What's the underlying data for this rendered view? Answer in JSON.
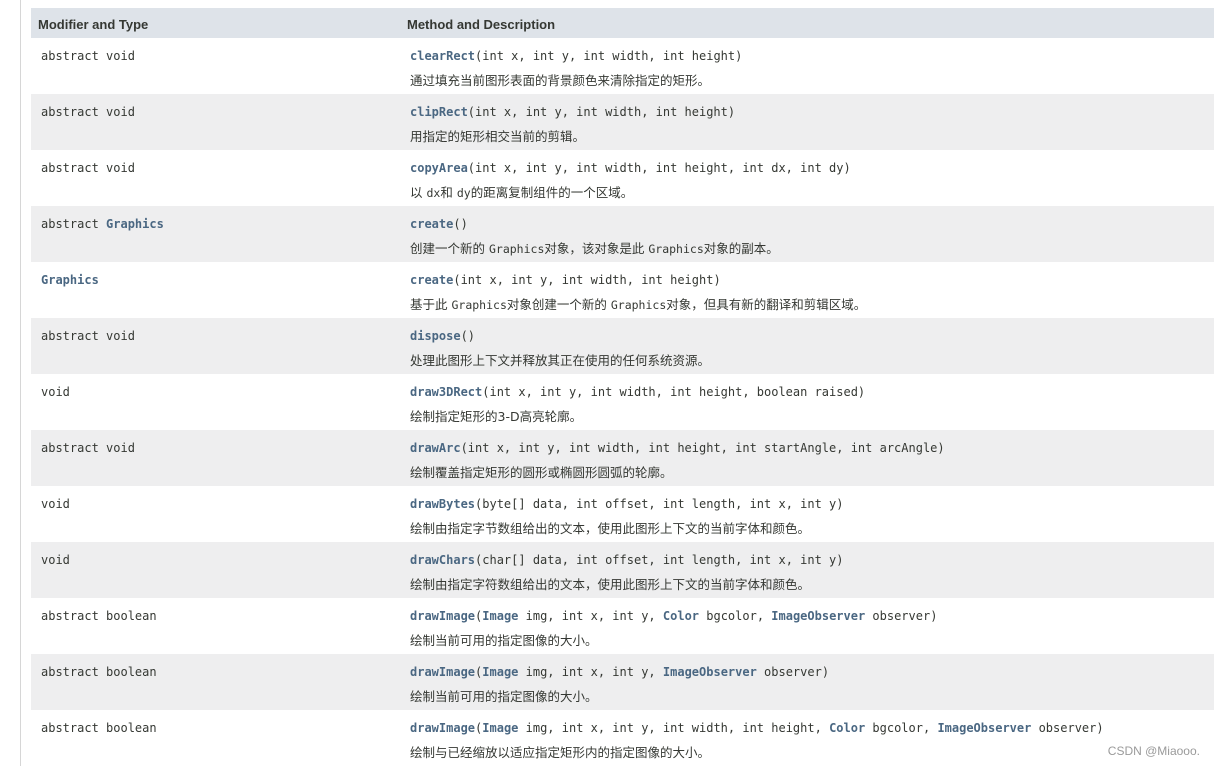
{
  "header": {
    "col1": "Modifier and Type",
    "col2": "Method and Description"
  },
  "rows": [
    {
      "modifier": [
        {
          "t": "abstract void"
        }
      ],
      "method": [
        {
          "t": "clearRect",
          "link": true
        },
        {
          "t": "(int x, int y, int width, int height)"
        }
      ],
      "description": [
        {
          "t": "通过填充当前图形表面的背景颜色来清除指定的矩形。"
        }
      ]
    },
    {
      "modifier": [
        {
          "t": "abstract void"
        }
      ],
      "method": [
        {
          "t": "clipRect",
          "link": true
        },
        {
          "t": "(int x, int y, int width, int height)"
        }
      ],
      "description": [
        {
          "t": "用指定的矩形相交当前的剪辑。"
        }
      ]
    },
    {
      "modifier": [
        {
          "t": "abstract void"
        }
      ],
      "method": [
        {
          "t": "copyArea",
          "link": true
        },
        {
          "t": "(int x, int y, int width, int height, int dx, int dy)"
        }
      ],
      "description": [
        {
          "t": "以 "
        },
        {
          "t": "dx",
          "code": true
        },
        {
          "t": "和 "
        },
        {
          "t": "dy",
          "code": true
        },
        {
          "t": "的距离复制组件的一个区域。"
        }
      ]
    },
    {
      "modifier": [
        {
          "t": "abstract "
        },
        {
          "t": "Graphics",
          "link": true
        }
      ],
      "method": [
        {
          "t": "create",
          "link": true
        },
        {
          "t": "()"
        }
      ],
      "description": [
        {
          "t": "创建一个新的 "
        },
        {
          "t": "Graphics",
          "code": true
        },
        {
          "t": "对象，该对象是此 "
        },
        {
          "t": "Graphics",
          "code": true
        },
        {
          "t": "对象的副本。"
        }
      ]
    },
    {
      "modifier": [
        {
          "t": "Graphics",
          "link": true
        }
      ],
      "method": [
        {
          "t": "create",
          "link": true
        },
        {
          "t": "(int x, int y, int width, int height)"
        }
      ],
      "description": [
        {
          "t": "基于此 "
        },
        {
          "t": "Graphics",
          "code": true
        },
        {
          "t": "对象创建一个新的 "
        },
        {
          "t": "Graphics",
          "code": true
        },
        {
          "t": "对象，但具有新的翻译和剪辑区域。"
        }
      ]
    },
    {
      "modifier": [
        {
          "t": "abstract void"
        }
      ],
      "method": [
        {
          "t": "dispose",
          "link": true
        },
        {
          "t": "()"
        }
      ],
      "description": [
        {
          "t": "处理此图形上下文并释放其正在使用的任何系统资源。"
        }
      ]
    },
    {
      "modifier": [
        {
          "t": "void"
        }
      ],
      "method": [
        {
          "t": "draw3DRect",
          "link": true
        },
        {
          "t": "(int x, int y, int width, int height, boolean raised)"
        }
      ],
      "description": [
        {
          "t": "绘制指定矩形的3-D高亮轮廓。"
        }
      ]
    },
    {
      "modifier": [
        {
          "t": "abstract void"
        }
      ],
      "method": [
        {
          "t": "drawArc",
          "link": true
        },
        {
          "t": "(int x, int y, int width, int height, int startAngle, int arcAngle)"
        }
      ],
      "description": [
        {
          "t": "绘制覆盖指定矩形的圆形或椭圆形圆弧的轮廓。"
        }
      ]
    },
    {
      "modifier": [
        {
          "t": "void"
        }
      ],
      "method": [
        {
          "t": "drawBytes",
          "link": true
        },
        {
          "t": "(byte[] data, int offset, int length, int x, int y)"
        }
      ],
      "description": [
        {
          "t": "绘制由指定字节数组给出的文本，使用此图形上下文的当前字体和颜色。"
        }
      ]
    },
    {
      "modifier": [
        {
          "t": "void"
        }
      ],
      "method": [
        {
          "t": "drawChars",
          "link": true
        },
        {
          "t": "(char[] data, int offset, int length, int x, int y)"
        }
      ],
      "description": [
        {
          "t": "绘制由指定字符数组给出的文本，使用此图形上下文的当前字体和颜色。"
        }
      ]
    },
    {
      "modifier": [
        {
          "t": "abstract boolean"
        }
      ],
      "method": [
        {
          "t": "drawImage",
          "link": true
        },
        {
          "t": "("
        },
        {
          "t": "Image",
          "link": true
        },
        {
          "t": " img, int x, int y, "
        },
        {
          "t": "Color",
          "link": true
        },
        {
          "t": " bgcolor, "
        },
        {
          "t": "ImageObserver",
          "link": true
        },
        {
          "t": " observer)"
        }
      ],
      "description": [
        {
          "t": "绘制当前可用的指定图像的大小。"
        }
      ]
    },
    {
      "modifier": [
        {
          "t": "abstract boolean"
        }
      ],
      "method": [
        {
          "t": "drawImage",
          "link": true
        },
        {
          "t": "("
        },
        {
          "t": "Image",
          "link": true
        },
        {
          "t": " img, int x, int y, "
        },
        {
          "t": "ImageObserver",
          "link": true
        },
        {
          "t": " observer)"
        }
      ],
      "description": [
        {
          "t": "绘制当前可用的指定图像的大小。"
        }
      ]
    },
    {
      "modifier": [
        {
          "t": "abstract boolean"
        }
      ],
      "method": [
        {
          "t": "drawImage",
          "link": true
        },
        {
          "t": "("
        },
        {
          "t": "Image",
          "link": true
        },
        {
          "t": " img, int x, int y, int width, int height, "
        },
        {
          "t": "Color",
          "link": true
        },
        {
          "t": " bgcolor, "
        },
        {
          "t": "ImageObserver",
          "link": true
        },
        {
          "t": " observer)"
        }
      ],
      "description": [
        {
          "t": "绘制与已经缩放以适应指定矩形内的指定图像的大小。"
        }
      ]
    }
  ],
  "watermark": "CSDN @Miaooo.",
  "colors": {
    "header_bg": "#dee3e9",
    "alt_row_bg": "#eeeeef",
    "text": "#353833",
    "link": "#4a6782"
  }
}
